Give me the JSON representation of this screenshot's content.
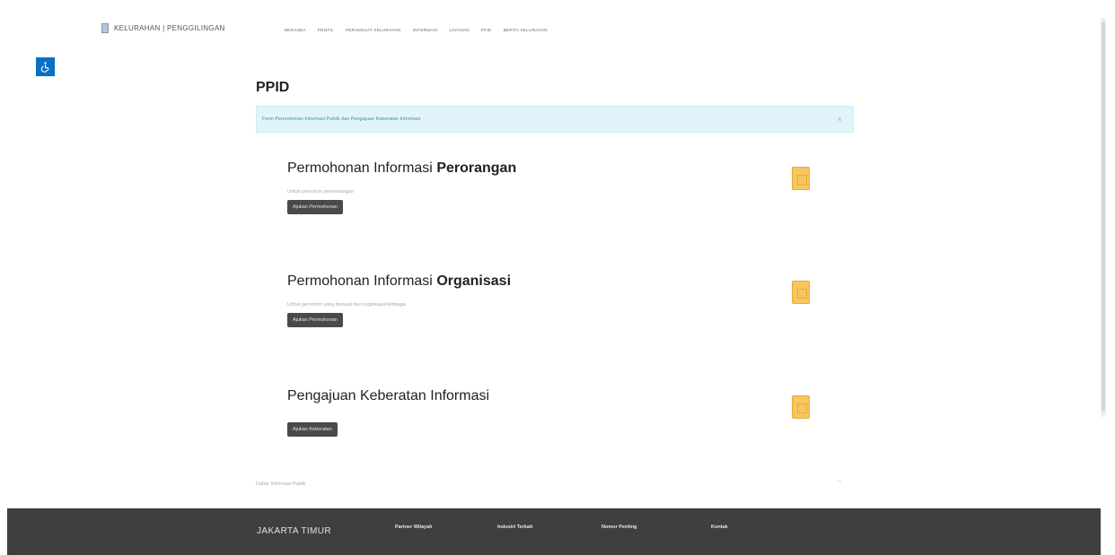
{
  "header": {
    "brand": "KELURAHAN | PENGGILINGAN",
    "nav": [
      "BERANDA",
      "PROFIL",
      "PERANGKAT KELURAHAN",
      "INFORMASI",
      "LAYANAN",
      "PPID",
      "BERITA KELURAHAN"
    ]
  },
  "accessibility": {
    "icon": "wheelchair-icon"
  },
  "page": {
    "title": "PPID",
    "alert": "Form Permohonan Informasi Publik dan Pengajuan Keberatan Informasi",
    "cards": [
      {
        "title_plain": "Permohonan Informasi ",
        "title_bold": "Perorangan",
        "desc": "Untuk pemohon perseorangan",
        "button": "Ajukan Permohonan"
      },
      {
        "title_plain": "Permohonan Informasi ",
        "title_bold": "Organisasi",
        "desc": "Untuk pemohon yang berasal dari organisasi/lembaga",
        "button": "Ajukan Permohonan"
      },
      {
        "title_plain": "Pengajuan Keberatan Informasi",
        "title_bold": "",
        "desc": "",
        "button": "Ajukan Keberatan"
      }
    ],
    "list_label": "Daftar Informasi Publik"
  },
  "footer": {
    "title": "JAKARTA TIMUR",
    "links": [
      "Partner Wilayah",
      "Industri Terkait",
      "Nomor Penting",
      "Kontak"
    ]
  },
  "colors": {
    "accent": "#0b6fc4",
    "footer": "#3f3f3f",
    "alert": "#e1f4fc",
    "icon": "#f7c65e"
  }
}
